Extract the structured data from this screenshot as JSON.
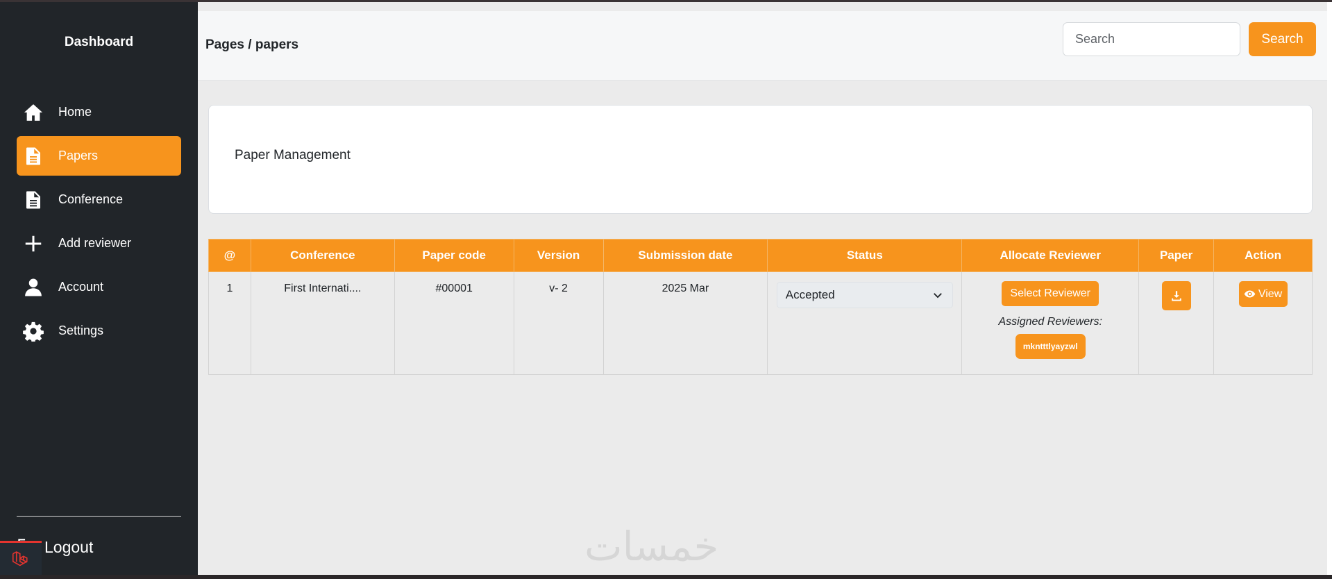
{
  "sidebar": {
    "title": "Dashboard",
    "items": [
      {
        "label": "Home",
        "icon": "home-icon"
      },
      {
        "label": "Papers",
        "icon": "document-icon",
        "active": true
      },
      {
        "label": "Conference",
        "icon": "document-icon"
      },
      {
        "label": "Add reviewer",
        "icon": "plus-icon"
      },
      {
        "label": "Account",
        "icon": "user-icon"
      },
      {
        "label": "Settings",
        "icon": "gear-icon"
      }
    ],
    "logout_label": "Logout"
  },
  "header": {
    "breadcrumb": "Pages / papers",
    "search_placeholder": "Search",
    "search_button": "Search"
  },
  "card": {
    "title": "Paper Management"
  },
  "table": {
    "columns": [
      "@",
      "Conference",
      "Paper code",
      "Version",
      "Submission date",
      "Status",
      "Allocate Reviewer",
      "Paper",
      "Action"
    ],
    "rows": [
      {
        "index": "1",
        "conference": "First Internati....",
        "paper_code": "#00001",
        "version": "v- 2",
        "submission_date": "2025 Mar",
        "status": "Accepted",
        "select_reviewer": "Select Reviewer",
        "assigned_label": "Assigned Reviewers:",
        "reviewer": "mkntttlyayzwl",
        "view_label": "View"
      }
    ]
  },
  "watermark": "خمسات",
  "colors": {
    "accent": "#f7941d",
    "sidebar_bg": "#212529",
    "main_bg": "#ebebeb"
  }
}
